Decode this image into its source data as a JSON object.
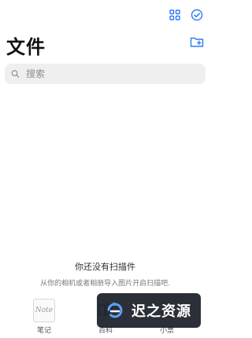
{
  "header": {
    "title": "文件",
    "icons": {
      "grid": "grid-icon",
      "check": "check-circle-icon",
      "new_folder": "new-folder-icon"
    }
  },
  "search": {
    "placeholder": "搜索",
    "icon": "search-icon"
  },
  "empty_state": {
    "title": "你还没有扫描件",
    "subtitle": "从你的相机或者相册导入图片开启扫描吧."
  },
  "toolbar": {
    "items": [
      {
        "label": "笔记",
        "thumb_text": "Note",
        "icon": "note-thumb-icon"
      },
      {
        "label": "百科",
        "icon": "book-icon"
      },
      {
        "label": "小票",
        "icon": "receipt-icon"
      }
    ]
  },
  "watermark": {
    "text": "迟之资源",
    "icon": "logo-icon"
  },
  "colors": {
    "accent": "#2f7bf5",
    "text": "#111111",
    "muted": "#8e8e93",
    "search_bg": "#efeff0",
    "watermark_bg": "#141821"
  }
}
